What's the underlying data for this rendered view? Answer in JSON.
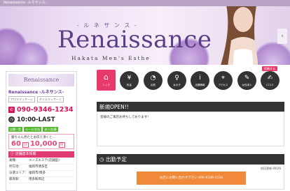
{
  "topbar": {
    "text": "Renaissance -ルネサンス-"
  },
  "hero": {
    "kana": "- ル ネ サ ン ス -",
    "title": "Renaissance",
    "subtitle": "Hakata Men's Esthe",
    "side_icon": "‹"
  },
  "sidebar": {
    "logo_text": "Renaissance",
    "shop_name": "Renaissance -ルネサンス-",
    "tags": [
      "アロママッサージ",
      "オイルマッサージ"
    ],
    "phone_icon": "phone-icon",
    "phone": "090-9346-1234",
    "hours": "10:00-LAST",
    "buttons": [
      "店舗一覧",
      "ルール/お店",
      "求人/応募"
    ],
    "promo": {
      "text": "銀ちゃん見たとお伝え頂くと…",
      "minutes": "60",
      "unit_min": "分",
      "price": "10,000",
      "unit_yen": "円"
    },
    "info_title": "店舗基本情報",
    "info": [
      {
        "k": "業種:",
        "v": "メンズエステ(店舗型)"
      },
      {
        "k": "所在地:",
        "v": "福岡市博多区"
      },
      {
        "k": "派遣エリア:",
        "v": "福岡市/博多"
      },
      {
        "k": "最寄駅:",
        "v": "博多駅周辺"
      }
    ]
  },
  "nav": {
    "home": {
      "icon": "⌂",
      "label": "トップ"
    },
    "items": [
      {
        "icon": "¥",
        "label": "料金"
      },
      {
        "icon": "◔",
        "label": "出勤"
      },
      {
        "icon": "♀",
        "label": "女の子"
      },
      {
        "icon": "i",
        "label": "店舗情報"
      },
      {
        "icon": "⌖",
        "label": "アクセス"
      },
      {
        "icon": "✎",
        "label": "女性求人"
      },
      {
        "icon": "✍",
        "label": "口コミ"
      }
    ],
    "badge": "投稿する"
  },
  "news": {
    "title": "新規OPEN!!",
    "body": "皆様のご来店お待ちしております!"
  },
  "schedule": {
    "title": "出勤予定",
    "date": "前回更新:09/26",
    "button": "お店にお問い合わせ下さい 090-9346-1234"
  }
}
